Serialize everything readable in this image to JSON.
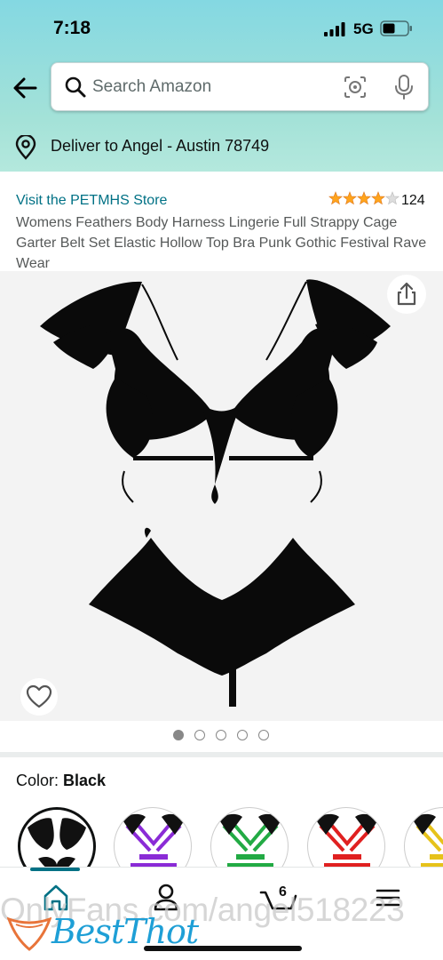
{
  "status_bar": {
    "time": "7:18",
    "network": "5G"
  },
  "search": {
    "placeholder": "Search Amazon"
  },
  "delivery": {
    "text": "Deliver to Angel - Austin 78749"
  },
  "product": {
    "store_link": "Visit the PETMHS Store",
    "rating_stars": 4,
    "rating_count": "124",
    "title": "Womens Feathers Body Harness Lingerie Full Strappy Cage Garter Belt Set Elastic Hollow Top Bra Punk Gothic Festival Rave Wear",
    "image_count": 5,
    "active_image": 1
  },
  "color": {
    "label": "Color: ",
    "value": "Black"
  },
  "swatches": [
    {
      "name": "black",
      "color": "#111111",
      "selected": true
    },
    {
      "name": "purple",
      "color": "#8a2bd6"
    },
    {
      "name": "green",
      "color": "#22aa44"
    },
    {
      "name": "red",
      "color": "#e02020"
    },
    {
      "name": "yellow",
      "color": "#e6c21a"
    }
  ],
  "tabbar": {
    "cart_count": "6",
    "icons": [
      "home-icon",
      "account-icon",
      "cart-icon",
      "menu-icon"
    ]
  },
  "watermark": {
    "text": "OnlyFans.com/angel518223",
    "brand": "BestThot"
  },
  "colors": {
    "accent": "#007185",
    "star": "#ffa41c",
    "header_top": "#84d8e2",
    "header_bottom": "#b4e8dd"
  }
}
